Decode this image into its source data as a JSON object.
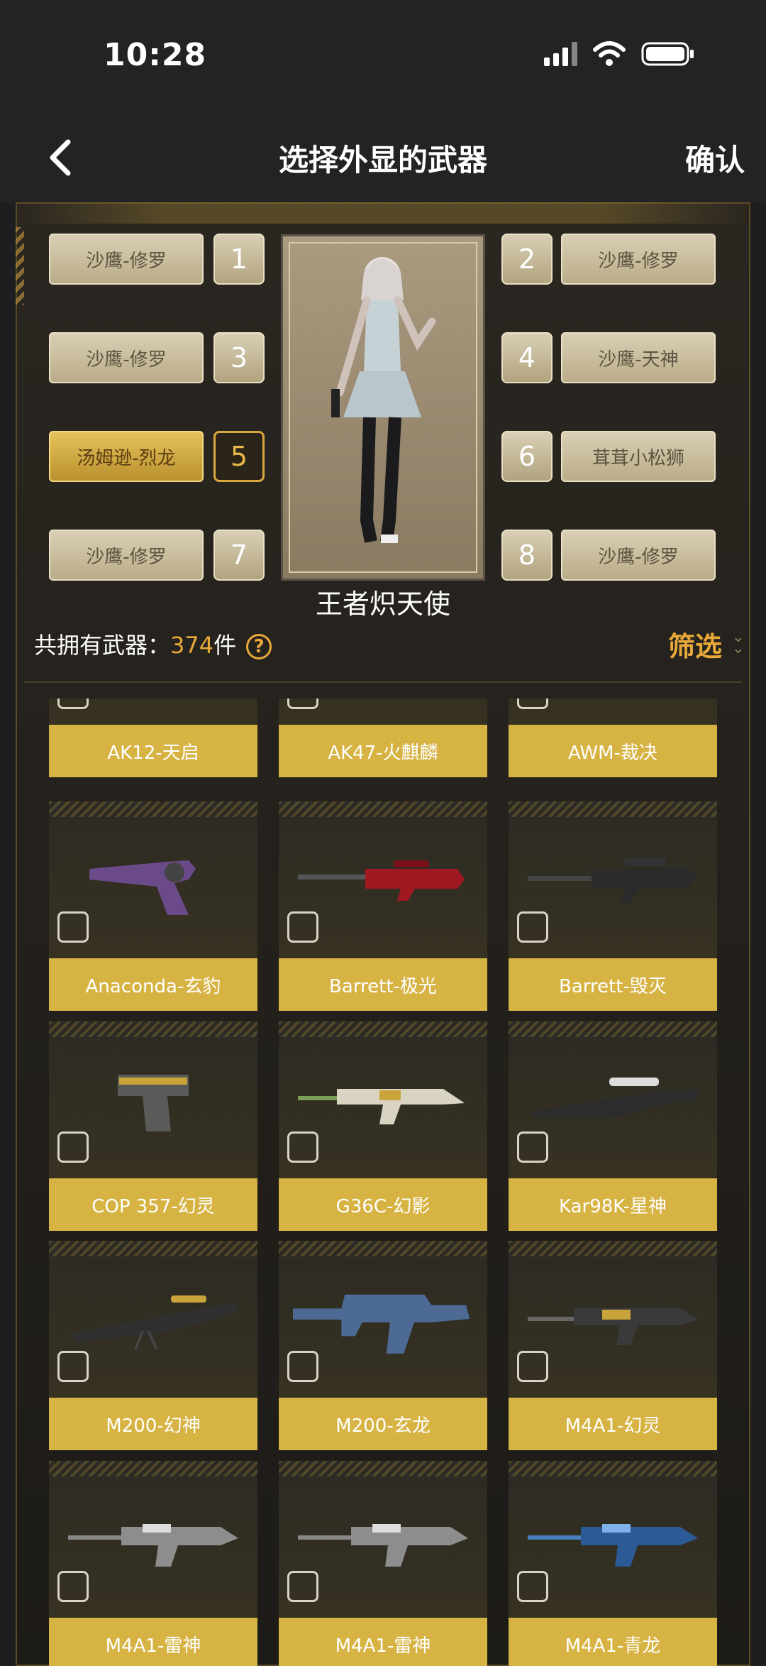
{
  "status": {
    "time": "10:28"
  },
  "nav": {
    "title": "选择外显的武器",
    "confirm": "确认"
  },
  "slots": [
    {
      "num": "1",
      "weapon": "沙鹰-修罗"
    },
    {
      "num": "2",
      "weapon": "沙鹰-修罗"
    },
    {
      "num": "3",
      "weapon": "沙鹰-修罗"
    },
    {
      "num": "4",
      "weapon": "沙鹰-天神"
    },
    {
      "num": "5",
      "weapon": "汤姆逊-烈龙",
      "active": true
    },
    {
      "num": "6",
      "weapon": "茸茸小松狮"
    },
    {
      "num": "7",
      "weapon": "沙鹰-修罗"
    },
    {
      "num": "8",
      "weapon": "沙鹰-修罗"
    }
  ],
  "character": {
    "name": "王者炽天使"
  },
  "summary": {
    "prefix": "共拥有武器：",
    "count": "374",
    "suffix": "件",
    "help": "?"
  },
  "filter": {
    "label": "筛选"
  },
  "weapons": [
    {
      "name": "AK12-天启",
      "icon": "rifle"
    },
    {
      "name": "AK47-火麒麟",
      "icon": "rifle"
    },
    {
      "name": "AWM-裁决",
      "icon": "sniper"
    },
    {
      "name": "Anaconda-玄豹",
      "icon": "revolver"
    },
    {
      "name": "Barrett-极光",
      "icon": "sniper"
    },
    {
      "name": "Barrett-毁灭",
      "icon": "sniper"
    },
    {
      "name": "COP 357-幻灵",
      "icon": "pistol"
    },
    {
      "name": "G36C-幻影",
      "icon": "rifle"
    },
    {
      "name": "Kar98K-星神",
      "icon": "sniper"
    },
    {
      "name": "M200-幻神",
      "icon": "sniper"
    },
    {
      "name": "M200-玄龙",
      "icon": "rifle-placeholder"
    },
    {
      "name": "M4A1-幻灵",
      "icon": "rifle"
    },
    {
      "name": "M4A1-雷神",
      "icon": "rifle"
    },
    {
      "name": "M4A1-雷神",
      "icon": "rifle"
    },
    {
      "name": "M4A1-青龙",
      "icon": "rifle"
    }
  ]
}
